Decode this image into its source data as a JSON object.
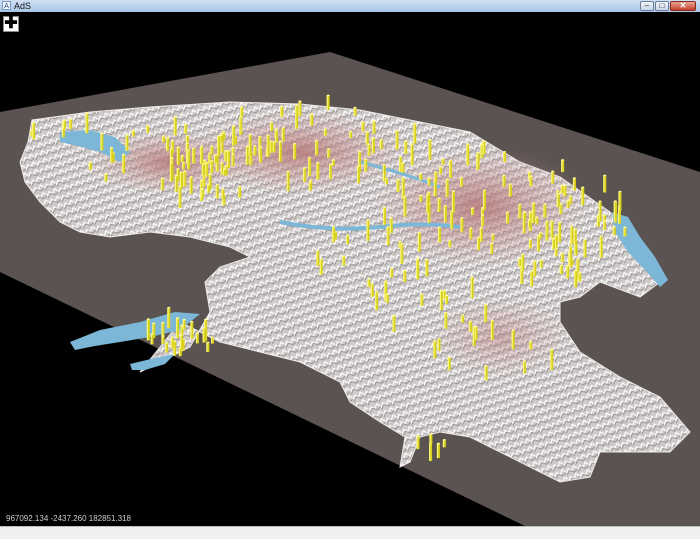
{
  "window": {
    "title": "AdS",
    "app_icon": "app-icon",
    "controls": {
      "minimize": "–",
      "maximize": "□",
      "close": "✕"
    }
  },
  "toolbar": {
    "add_symbol": "✚",
    "add_icon": "plus-icon"
  },
  "viewport": {
    "coordinates": "967092.134 -2437.260 182851.318"
  },
  "colors": {
    "background": "#000000",
    "ground_plane": "#5b5351",
    "terrain_relief": "#d9d3d3",
    "urban_areas": "#c99595",
    "lakes": "#7cb7d8",
    "bars": "#e8e020"
  }
}
